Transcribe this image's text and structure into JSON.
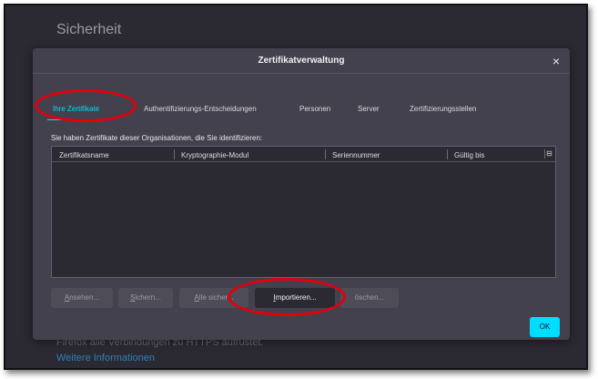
{
  "background": {
    "section_title": "Sicherheit",
    "info_text": "Firefox alle Verbindungen zu HTTPS aufrüstet.",
    "more_info_link": "Weitere Informationen"
  },
  "dialog": {
    "title": "Zertifikatverwaltung",
    "close_icon": "×"
  },
  "tabs": [
    {
      "label": "Ihre Zertifikate",
      "active": true
    },
    {
      "label": "Authentifizierungs-Entscheidungen",
      "active": false
    },
    {
      "label": "Personen",
      "active": false
    },
    {
      "label": "Server",
      "active": false
    },
    {
      "label": "Zertifizierungsstellen",
      "active": false
    }
  ],
  "description": "Sie haben Zertifikate dieser Organisationen, die Sie identifizieren:",
  "table": {
    "columns": [
      "Zertifikatsname",
      "Kryptographie-Modul",
      "Seriennummer",
      "Gültig bis"
    ],
    "column_picker_icon": "⊟",
    "rows": []
  },
  "buttons": {
    "view": {
      "key": "A",
      "rest": "nsehen..."
    },
    "backup": {
      "key": "S",
      "rest": "ichern..."
    },
    "backup_all": {
      "key": "A",
      "rest": "lle sicher..."
    },
    "import": {
      "key": "I",
      "rest": "mportieren..."
    },
    "delete": {
      "text": "öschen..."
    },
    "ok": "OK"
  },
  "colors": {
    "accent": "#00ddff",
    "dialog_bg": "#42414d",
    "table_bg": "#2b2a33",
    "annotation": "#e4000b"
  }
}
